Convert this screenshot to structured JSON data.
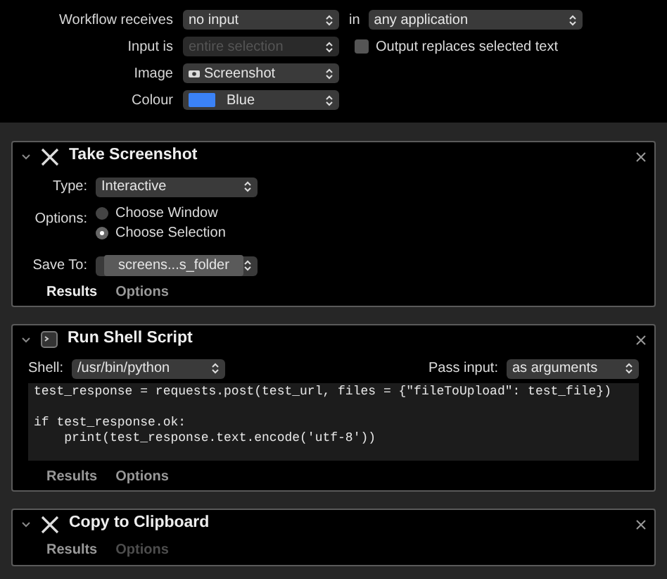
{
  "workflow": {
    "receives_label": "Workflow receives",
    "receives": "no input",
    "in_label": "in",
    "application": "any application",
    "input_is_label": "Input is",
    "input_is": "entire selection",
    "input_is_disabled": true,
    "output_replaces": {
      "label": "Output replaces selected text",
      "checked": false
    },
    "image_label": "Image",
    "image": "Screenshot",
    "colour_label": "Colour",
    "colour": "Blue"
  },
  "actions": [
    {
      "kind": "screenshot",
      "title": "Take Screenshot",
      "expanded": true,
      "type_label": "Type:",
      "type": "Interactive",
      "options_label": "Options:",
      "radios": [
        {
          "label": "Choose Window",
          "selected": false
        },
        {
          "label": "Choose Selection",
          "selected": true
        }
      ],
      "save_label": "Save To:",
      "save_to": "screens...s_folder",
      "tabs": [
        {
          "label": "Results",
          "selected": true,
          "disabled": false
        },
        {
          "label": "Options",
          "selected": false,
          "disabled": false
        }
      ]
    },
    {
      "kind": "shell",
      "title": "Run Shell Script",
      "expanded": true,
      "shell_label": "Shell:",
      "shell": "/usr/bin/python",
      "pass_label": "Pass input:",
      "pass_input": "as arguments",
      "code": [
        {
          "text": "test_response = requests.post(test_url, files = {\"fileToUpload\": test_file})",
          "blank_after": true
        },
        {
          "text": "if test_response.ok:",
          "blank_after": false
        },
        {
          "text": "    print(test_response.text.encode('utf-8'))",
          "blank_after": false
        }
      ],
      "tabs": [
        {
          "label": "Results",
          "selected": false,
          "disabled": false
        },
        {
          "label": "Options",
          "selected": false,
          "disabled": false
        }
      ]
    },
    {
      "kind": "clipboard",
      "title": "Copy to Clipboard",
      "expanded": true,
      "tabs": [
        {
          "label": "Results",
          "selected": false,
          "disabled": false
        },
        {
          "label": "Options",
          "selected": false,
          "disabled": true
        }
      ]
    }
  ]
}
